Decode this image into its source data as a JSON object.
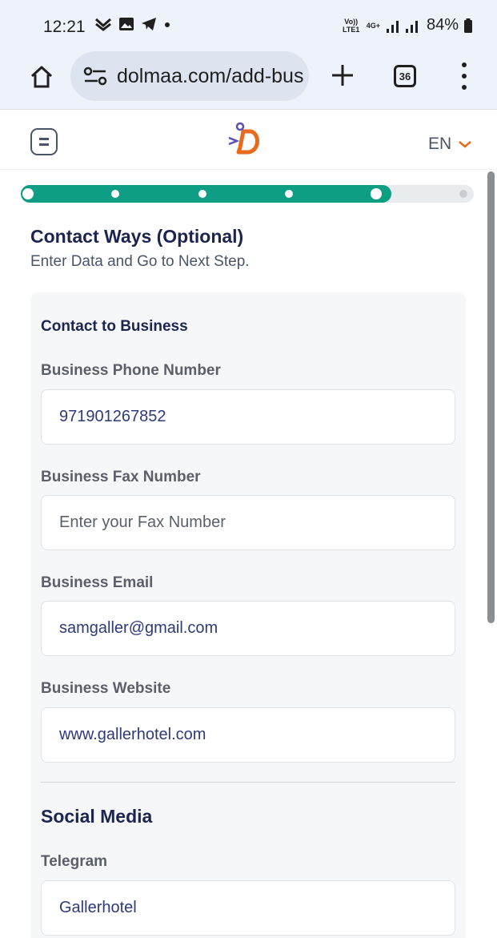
{
  "status_bar": {
    "time": "12:21",
    "network_line1": "Vo)) LTE1",
    "network_4g": "4G+",
    "battery": "84%",
    "icons": [
      "missed-call-icon",
      "gallery-icon",
      "telegram-icon",
      "dot-icon",
      "signal-icon",
      "battery-icon"
    ]
  },
  "browser": {
    "url": "dolmaa.com/add-bus",
    "tab_count": "36",
    "icons": [
      "home-icon",
      "site-settings-icon",
      "plus-icon",
      "tabs-icon",
      "more-vert-icon"
    ]
  },
  "site_header": {
    "language": "EN",
    "icons": [
      "menu-icon",
      "dolmaa-logo",
      "chevron-down-icon"
    ]
  },
  "progress": {
    "total_steps": 6,
    "current_step": 5,
    "percent": 80
  },
  "page": {
    "title": "Contact Ways (Optional)",
    "subtitle": "Enter Data and Go to Next Step."
  },
  "contact": {
    "heading": "Contact to Business",
    "fields": [
      {
        "label": "Business Phone Number",
        "value": "971901267852",
        "placeholder": ""
      },
      {
        "label": "Business Fax Number",
        "value": "",
        "placeholder": "Enter your Fax Number"
      },
      {
        "label": "Business Email",
        "value": "samgaller@gmail.com",
        "placeholder": ""
      },
      {
        "label": "Business Website",
        "value": "www.gallerhotel.com",
        "placeholder": ""
      }
    ]
  },
  "social": {
    "heading": "Social Media",
    "fields": [
      {
        "label": "Telegram",
        "value": "Gallerhotel",
        "placeholder": ""
      }
    ]
  },
  "colors": {
    "accent": "#0e9e84",
    "heading": "#1b2550",
    "input_text": "#2e3a7a",
    "brand_orange": "#e86a1c"
  }
}
